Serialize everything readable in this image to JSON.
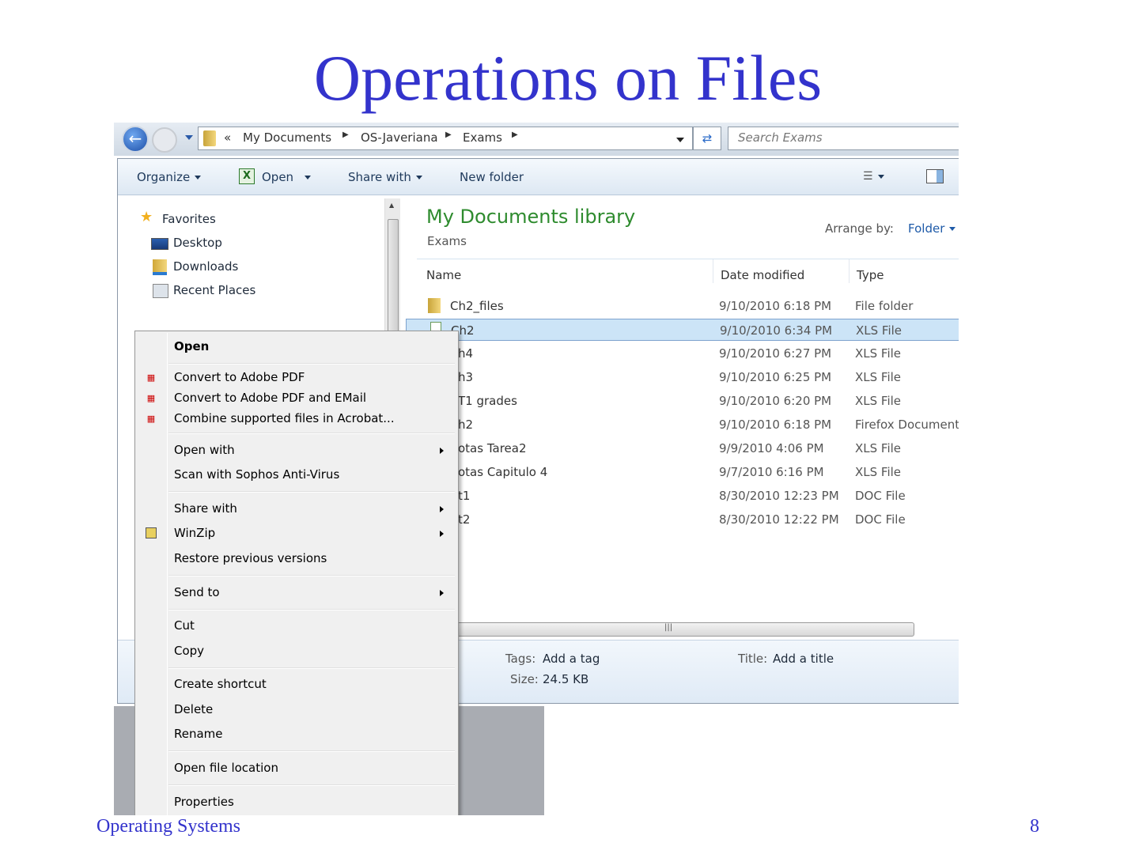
{
  "slide": {
    "title": "Operations on Files",
    "footer_left": "Operating Systems",
    "page_number": "8"
  },
  "address": {
    "overflow": "«",
    "crumbs": [
      "My Documents",
      "OS-Javeriana",
      "Exams"
    ],
    "search_placeholder": "Search Exams"
  },
  "toolbar": {
    "organize": "Organize",
    "open": "Open",
    "share_with": "Share with",
    "new_folder": "New folder"
  },
  "nav": {
    "favorites": "Favorites",
    "items": [
      "Desktop",
      "Downloads",
      "Recent Places"
    ]
  },
  "library": {
    "title": "My Documents library",
    "subtitle": "Exams",
    "arrange_label": "Arrange by:",
    "arrange_value": "Folder"
  },
  "columns": {
    "name": "Name",
    "date": "Date modified",
    "type": "Type"
  },
  "files": [
    {
      "name": "Ch2_files",
      "date": "9/10/2010 6:18 PM",
      "type": "File folder"
    },
    {
      "name": "Ch2",
      "date": "9/10/2010 6:34 PM",
      "type": "XLS File"
    },
    {
      "name": "h4",
      "date": "9/10/2010 6:27 PM",
      "type": "XLS File"
    },
    {
      "name": "h3",
      "date": "9/10/2010 6:25 PM",
      "type": "XLS File"
    },
    {
      "name": "T1 grades",
      "date": "9/10/2010 6:20 PM",
      "type": "XLS File"
    },
    {
      "name": "h2",
      "date": "9/10/2010 6:18 PM",
      "type": "Firefox Document"
    },
    {
      "name": "otas Tarea2",
      "date": "9/9/2010 4:06 PM",
      "type": "XLS File"
    },
    {
      "name": "otas Capitulo 4",
      "date": "9/7/2010 6:16 PM",
      "type": "XLS File"
    },
    {
      "name": "t1",
      "date": "8/30/2010 12:23 PM",
      "type": "DOC File"
    },
    {
      "name": "t2",
      "date": "8/30/2010 12:22 PM",
      "type": "DOC File"
    }
  ],
  "details": {
    "tags_label": "Tags:",
    "tags_value": "Add a tag",
    "size_label": "Size:",
    "size_value": "24.5 KB",
    "title_label": "Title:",
    "title_value": "Add a title"
  },
  "menu": {
    "open": "Open",
    "pdf": "Convert to Adobe PDF",
    "pdf_email": "Convert to Adobe PDF and EMail",
    "combine": "Combine supported files in Acrobat...",
    "open_with": "Open with",
    "scan": "Scan with Sophos Anti-Virus",
    "share_with": "Share with",
    "winzip": "WinZip",
    "restore": "Restore previous versions",
    "send_to": "Send to",
    "cut": "Cut",
    "copy": "Copy",
    "create_shortcut": "Create shortcut",
    "delete": "Delete",
    "rename": "Rename",
    "open_location": "Open file location",
    "properties": "Properties"
  }
}
